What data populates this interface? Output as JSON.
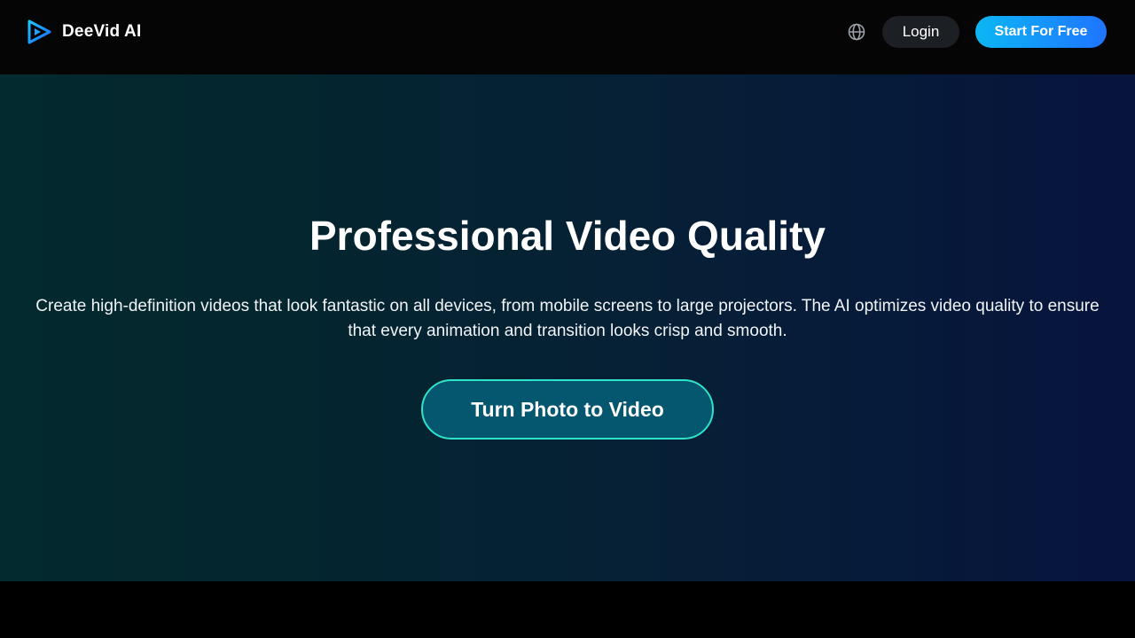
{
  "header": {
    "brand_name": "DeeVid AI",
    "logo_icon": "play-triangle-logo",
    "language_icon": "globe-icon",
    "login_label": "Login",
    "start_label": "Start For Free"
  },
  "hero": {
    "title": "Professional Video Quality",
    "description": "Create high-definition videos that look fantastic on all devices, from mobile screens to large projectors. The AI optimizes video quality to ensure that every animation and transition looks crisp and smooth.",
    "cta_label": "Turn Photo to Video"
  },
  "colors": {
    "accent_gradient_start": "#0cb7f4",
    "accent_gradient_end": "#1e74ff",
    "cta_border": "#2fe3c9",
    "cta_fill": "#05566f"
  }
}
